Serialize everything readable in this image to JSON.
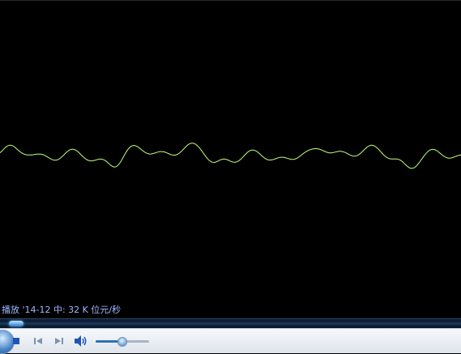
{
  "visualization": {
    "wave_color": "#c4ff7a"
  },
  "status_text": "播放 '14-12 中: 32 K 位元/秒",
  "seek": {
    "position_fraction": 0.02
  },
  "controls": {
    "play_icon": "play-pause-orb",
    "stop_icon": "stop-icon",
    "prev_icon": "previous-icon",
    "next_icon": "next-icon",
    "volume_icon": "speaker-icon",
    "volume_fraction": 0.5
  },
  "colors": {
    "accent": "#2f6fbd",
    "status": "#9fb7ff"
  }
}
